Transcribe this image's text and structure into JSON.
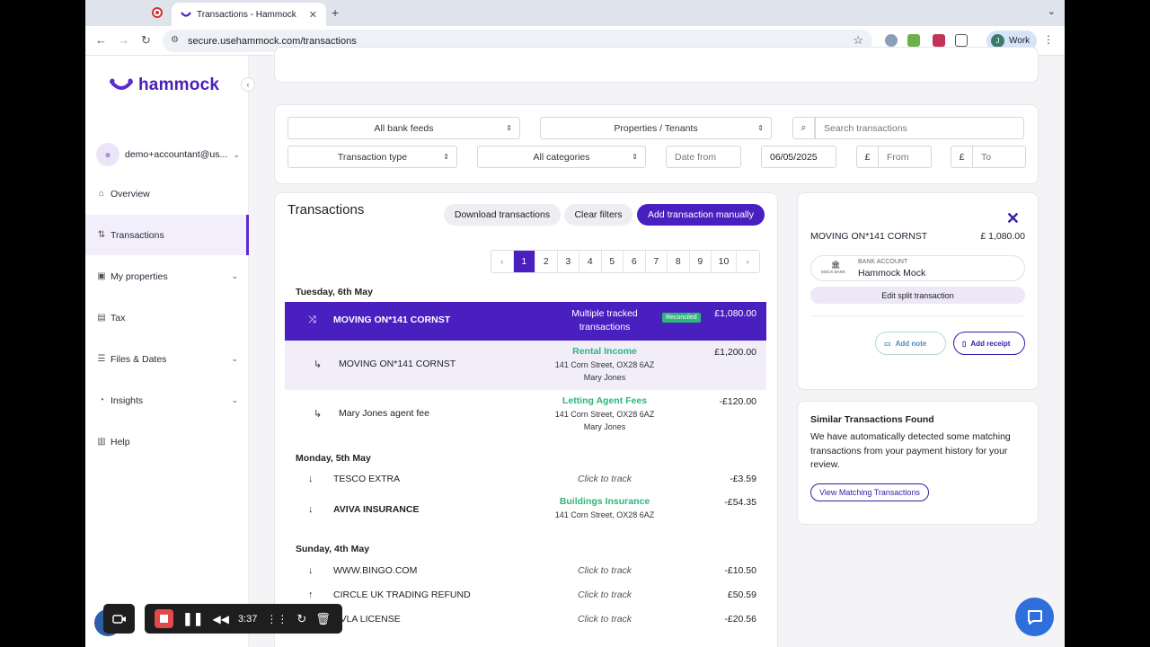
{
  "browser": {
    "tab_title": "Transactions - Hammock",
    "url": "secure.usehammock.com/transactions",
    "profile_initial": "J",
    "profile_name": "Work"
  },
  "sidebar": {
    "logo": "hammock",
    "user": "demo+accountant@us...",
    "items": [
      {
        "label": "Overview",
        "icon": "home-icon"
      },
      {
        "label": "Transactions",
        "icon": "swap-icon"
      },
      {
        "label": "My properties",
        "icon": "building-icon"
      },
      {
        "label": "Tax",
        "icon": "document-icon"
      },
      {
        "label": "Files & Dates",
        "icon": "list-icon"
      },
      {
        "label": "Insights",
        "icon": "pie-chart-icon"
      },
      {
        "label": "Help",
        "icon": "help-icon"
      }
    ]
  },
  "filters": {
    "bank_feeds": "All bank feeds",
    "properties": "Properties / Tenants",
    "search_placeholder": "Search transactions",
    "type": "Transaction type",
    "categories": "All categories",
    "date_from_placeholder": "Date from",
    "date_to": "06/05/2025",
    "currency": "£",
    "amount_from_placeholder": "From",
    "amount_to_placeholder": "To"
  },
  "transactions": {
    "title": "Transactions",
    "download": "Download transactions",
    "clear": "Clear filters",
    "add": "Add transaction manually",
    "pages": [
      "‹",
      "1",
      "2",
      "3",
      "4",
      "5",
      "6",
      "7",
      "8",
      "9",
      "10",
      "›"
    ],
    "current_page": "1",
    "days": [
      {
        "label": "Tuesday, 6th May"
      },
      {
        "label": "Monday, 5th May"
      },
      {
        "label": "Sunday, 4th May"
      }
    ],
    "rows": [
      {
        "name": "MOVING ON*141 CORNST",
        "mid1": "Multiple tracked",
        "mid2": "transactions",
        "badge": "Reconciled",
        "amount": "£1,080.00"
      },
      {
        "name": "MOVING ON*141 CORNST",
        "category": "Rental Income",
        "address": "141 Corn Street, OX28 6AZ",
        "tenant": "Mary Jones",
        "amount": "£1,200.00"
      },
      {
        "name": "Mary Jones agent fee",
        "category": "Letting Agent Fees",
        "address": "141 Corn Street, OX28 6AZ",
        "tenant": "Mary Jones",
        "amount": "-£120.00"
      },
      {
        "name": "TESCO EXTRA",
        "track": "Click to track",
        "amount": "-£3.59"
      },
      {
        "name": "AVIVA INSURANCE",
        "category": "Buildings Insurance",
        "address": "141 Corn Street, OX28 6AZ",
        "amount": "-£54.35"
      },
      {
        "name": "WWW.BINGO.COM",
        "track": "Click to track",
        "amount": "-£10.50"
      },
      {
        "name": "CIRCLE UK TRADING REFUND",
        "track": "Click to track",
        "amount": "£50.59"
      },
      {
        "name": "DVLA LICENSE",
        "track": "Click to track",
        "amount": "-£20.56"
      }
    ]
  },
  "detail": {
    "name": "MOVING ON*141 CORNST",
    "amount": "£ 1,080.00",
    "bank_label": "BANK ACCOUNT",
    "bank_logo": "MOCK BANK",
    "bank_name": "Hammock Mock",
    "edit_split": "Edit split transaction",
    "add_note": "Add note",
    "add_receipt": "Add receipt"
  },
  "similar": {
    "title": "Similar Transactions Found",
    "body": "We have automatically detected some matching transactions from your payment history for your review.",
    "button": "View Matching Transactions"
  },
  "recorder": {
    "time": "3:37"
  },
  "colors": {
    "brand": "#4a1fc0",
    "category_green": "#2fb57a",
    "reconciled": "#2fb57a"
  }
}
